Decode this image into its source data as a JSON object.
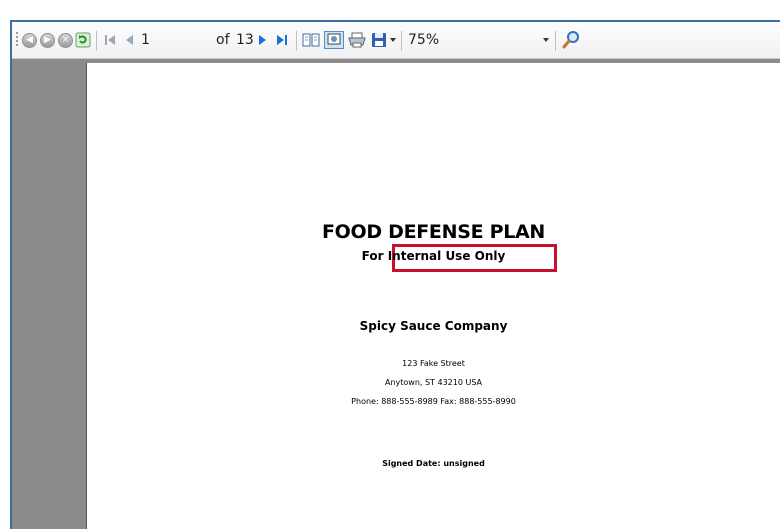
{
  "toolbar": {
    "page_current": "1",
    "page_of": "of",
    "page_total": "13",
    "zoom": "75%"
  },
  "document": {
    "title": "FOOD DEFENSE PLAN",
    "subtitle": "For Internal Use Only",
    "company": "Spicy Sauce Company",
    "address_line1": "123 Fake Street",
    "address_line2": "Anytown, ST 43210 USA",
    "phone_fax": "Phone: 888-555-8989  Fax: 888-555-8990",
    "signed_date": "Signed Date: unsigned"
  },
  "colors": {
    "highlight_box": "#c8102e",
    "accent_blue": "#1c6fd6",
    "viewport_gray": "#8b8b8b"
  }
}
